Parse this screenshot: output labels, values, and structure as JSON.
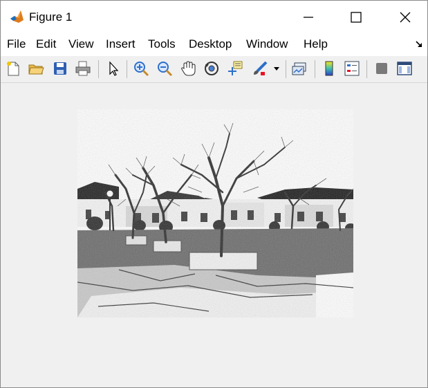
{
  "window": {
    "title": "Figure 1",
    "controls": [
      "minimize-icon",
      "maximize-icon",
      "close-icon"
    ]
  },
  "menu": {
    "items": [
      "File",
      "Edit",
      "View",
      "Insert",
      "Tools",
      "Desktop",
      "Window",
      "Help"
    ]
  },
  "toolbar": {
    "buttons": [
      "new-figure-icon",
      "open-file-icon",
      "save-icon",
      "print-icon",
      "edit-plot-arrow-icon",
      "zoom-in-icon",
      "zoom-out-icon",
      "pan-hand-icon",
      "rotate-3d-icon",
      "data-cursor-icon",
      "brush-icon",
      "link-plot-icon",
      "colorbar-icon",
      "legend-icon",
      "hide-plot-tools-icon",
      "show-plot-tools-icon"
    ]
  },
  "figure": {
    "content": "grayscale image of bare trees in planters on a paved courtyard",
    "background": "#f0f0f0"
  },
  "colors": {
    "chrome": "#f0f0f0",
    "titlebar": "#ffffff",
    "brush_red": "#e81123",
    "save_blue": "#2f5fb3"
  }
}
